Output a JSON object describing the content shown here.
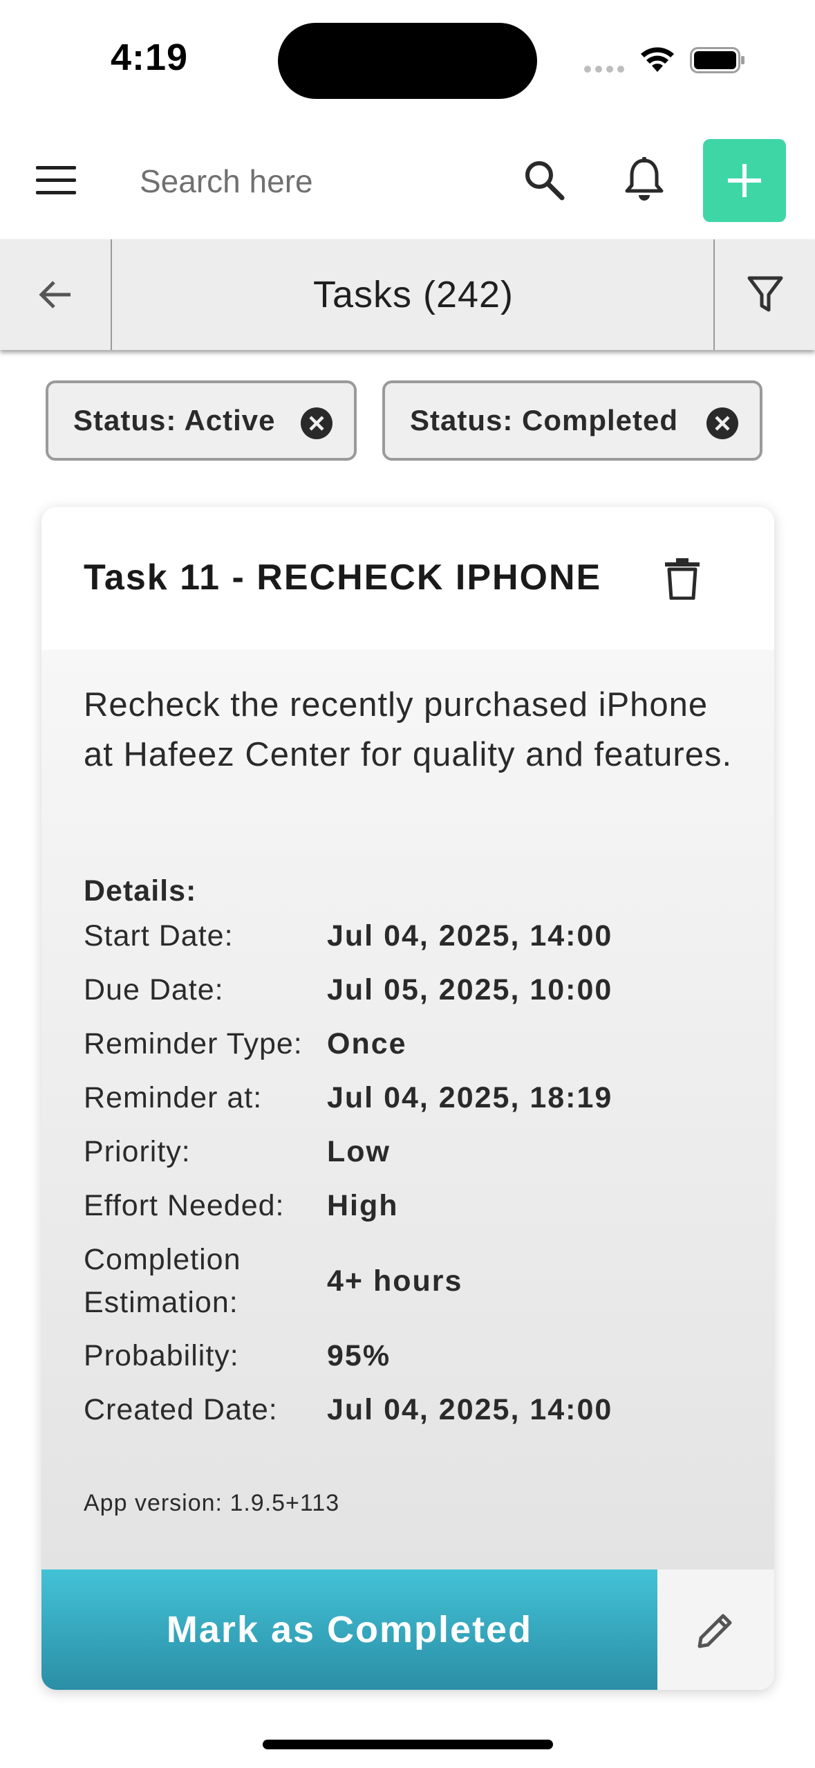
{
  "status_bar": {
    "time": "4:19"
  },
  "header": {
    "search_placeholder": "Search here"
  },
  "title_bar": {
    "title": "Tasks (242)"
  },
  "filters": [
    {
      "label": "Status: Active"
    },
    {
      "label": "Status: Completed"
    }
  ],
  "task": {
    "title": "Task 11 - RECHECK IPHONE",
    "description": "Recheck the recently purchased iPhone at Hafeez Center for quality and features.",
    "details_heading": "Details:",
    "details": [
      {
        "label": "Start Date:",
        "value": "Jul 04, 2025, 14:00"
      },
      {
        "label": "Due Date:",
        "value": "Jul 05, 2025, 10:00"
      },
      {
        "label": "Reminder Type:",
        "value": "Once"
      },
      {
        "label": "Reminder at:",
        "value": "Jul 04, 2025, 18:19"
      },
      {
        "label": "Priority:",
        "value": "Low"
      },
      {
        "label": "Effort Needed:",
        "value": "High"
      },
      {
        "label": "Completion Estimation:",
        "value": "4+ hours"
      },
      {
        "label": "Probability:",
        "value": "95%"
      },
      {
        "label": "Created Date:",
        "value": "Jul 04, 2025, 14:00"
      }
    ],
    "app_version": "App version:  1.9.5+113",
    "complete_label": "Mark as Completed"
  },
  "colors": {
    "accent_green": "#3fd6a5",
    "complete_button_top": "#43c2d6",
    "complete_button_bottom": "#2a8ea6"
  },
  "icons": {
    "menu": "menu-icon",
    "search": "search-icon",
    "bell": "bell-icon",
    "add": "plus-icon",
    "back": "arrow-left-icon",
    "filter": "filter-icon",
    "chip_close": "close-circle-icon",
    "delete": "trash-icon",
    "edit": "pencil-icon"
  }
}
